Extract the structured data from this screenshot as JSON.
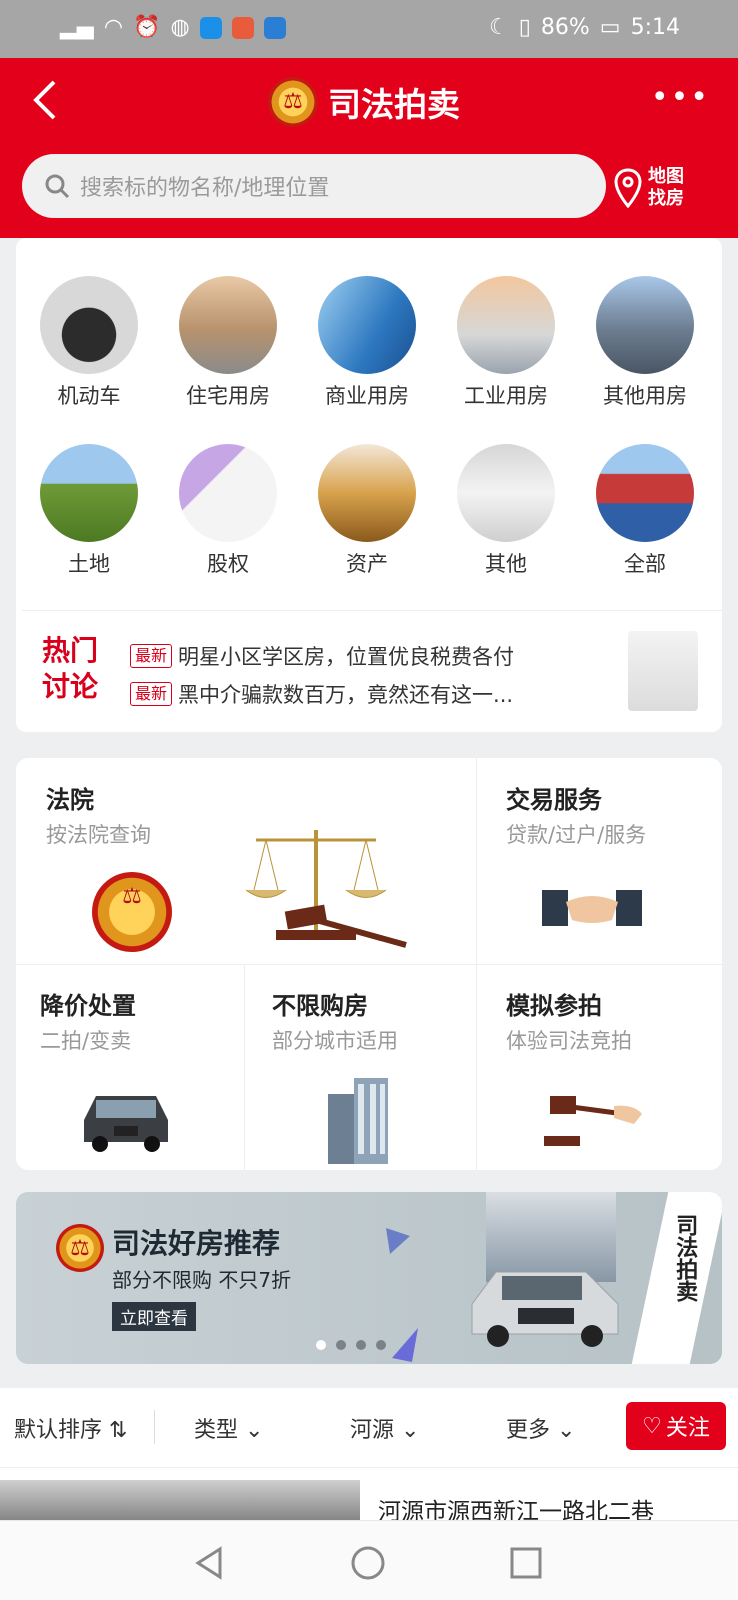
{
  "status": {
    "battery": "86%",
    "time": "5:14"
  },
  "header": {
    "title": "司法拍卖",
    "search_placeholder": "搜索标的物名称/地理位置",
    "map_label_1": "地图",
    "map_label_2": "找房",
    "more": "•••"
  },
  "categories": [
    {
      "label": "机动车"
    },
    {
      "label": "住宅用房"
    },
    {
      "label": "商业用房"
    },
    {
      "label": "工业用房"
    },
    {
      "label": "其他用房"
    },
    {
      "label": "土地"
    },
    {
      "label": "股权"
    },
    {
      "label": "资产"
    },
    {
      "label": "其他"
    },
    {
      "label": "全部"
    }
  ],
  "hot": {
    "tag_1": "热门",
    "tag_2": "讨论",
    "items": [
      {
        "badge": "最新",
        "text": "明星小区学区房，位置优良税费各付"
      },
      {
        "badge": "最新",
        "text": "黑中介骗款数百万，竟然还有这一..."
      }
    ]
  },
  "services": {
    "court": {
      "title": "法院",
      "sub": "按法院查询"
    },
    "trade": {
      "title": "交易服务",
      "sub": "贷款/过户/服务"
    },
    "discount": {
      "title": "降价处置",
      "sub": "二拍/变卖"
    },
    "unlimited": {
      "title": "不限购房",
      "sub": "部分城市适用"
    },
    "mock": {
      "title": "模拟参拍",
      "sub": "体验司法竞拍"
    }
  },
  "banner": {
    "title": "司法好房推荐",
    "sub": "部分不限购 不只7折",
    "button": "立即查看",
    "ribbon": "司法拍卖"
  },
  "filters": {
    "sort": "默认排序 ⇅",
    "type": "类型 ⌄",
    "city": "河源 ⌄",
    "more": "更多 ⌄",
    "follow": "关注"
  },
  "listing": {
    "title": "河源市源西新江一路北二巷"
  },
  "colors": {
    "brand": "#e3001b",
    "page_bg": "#eeeff1"
  }
}
